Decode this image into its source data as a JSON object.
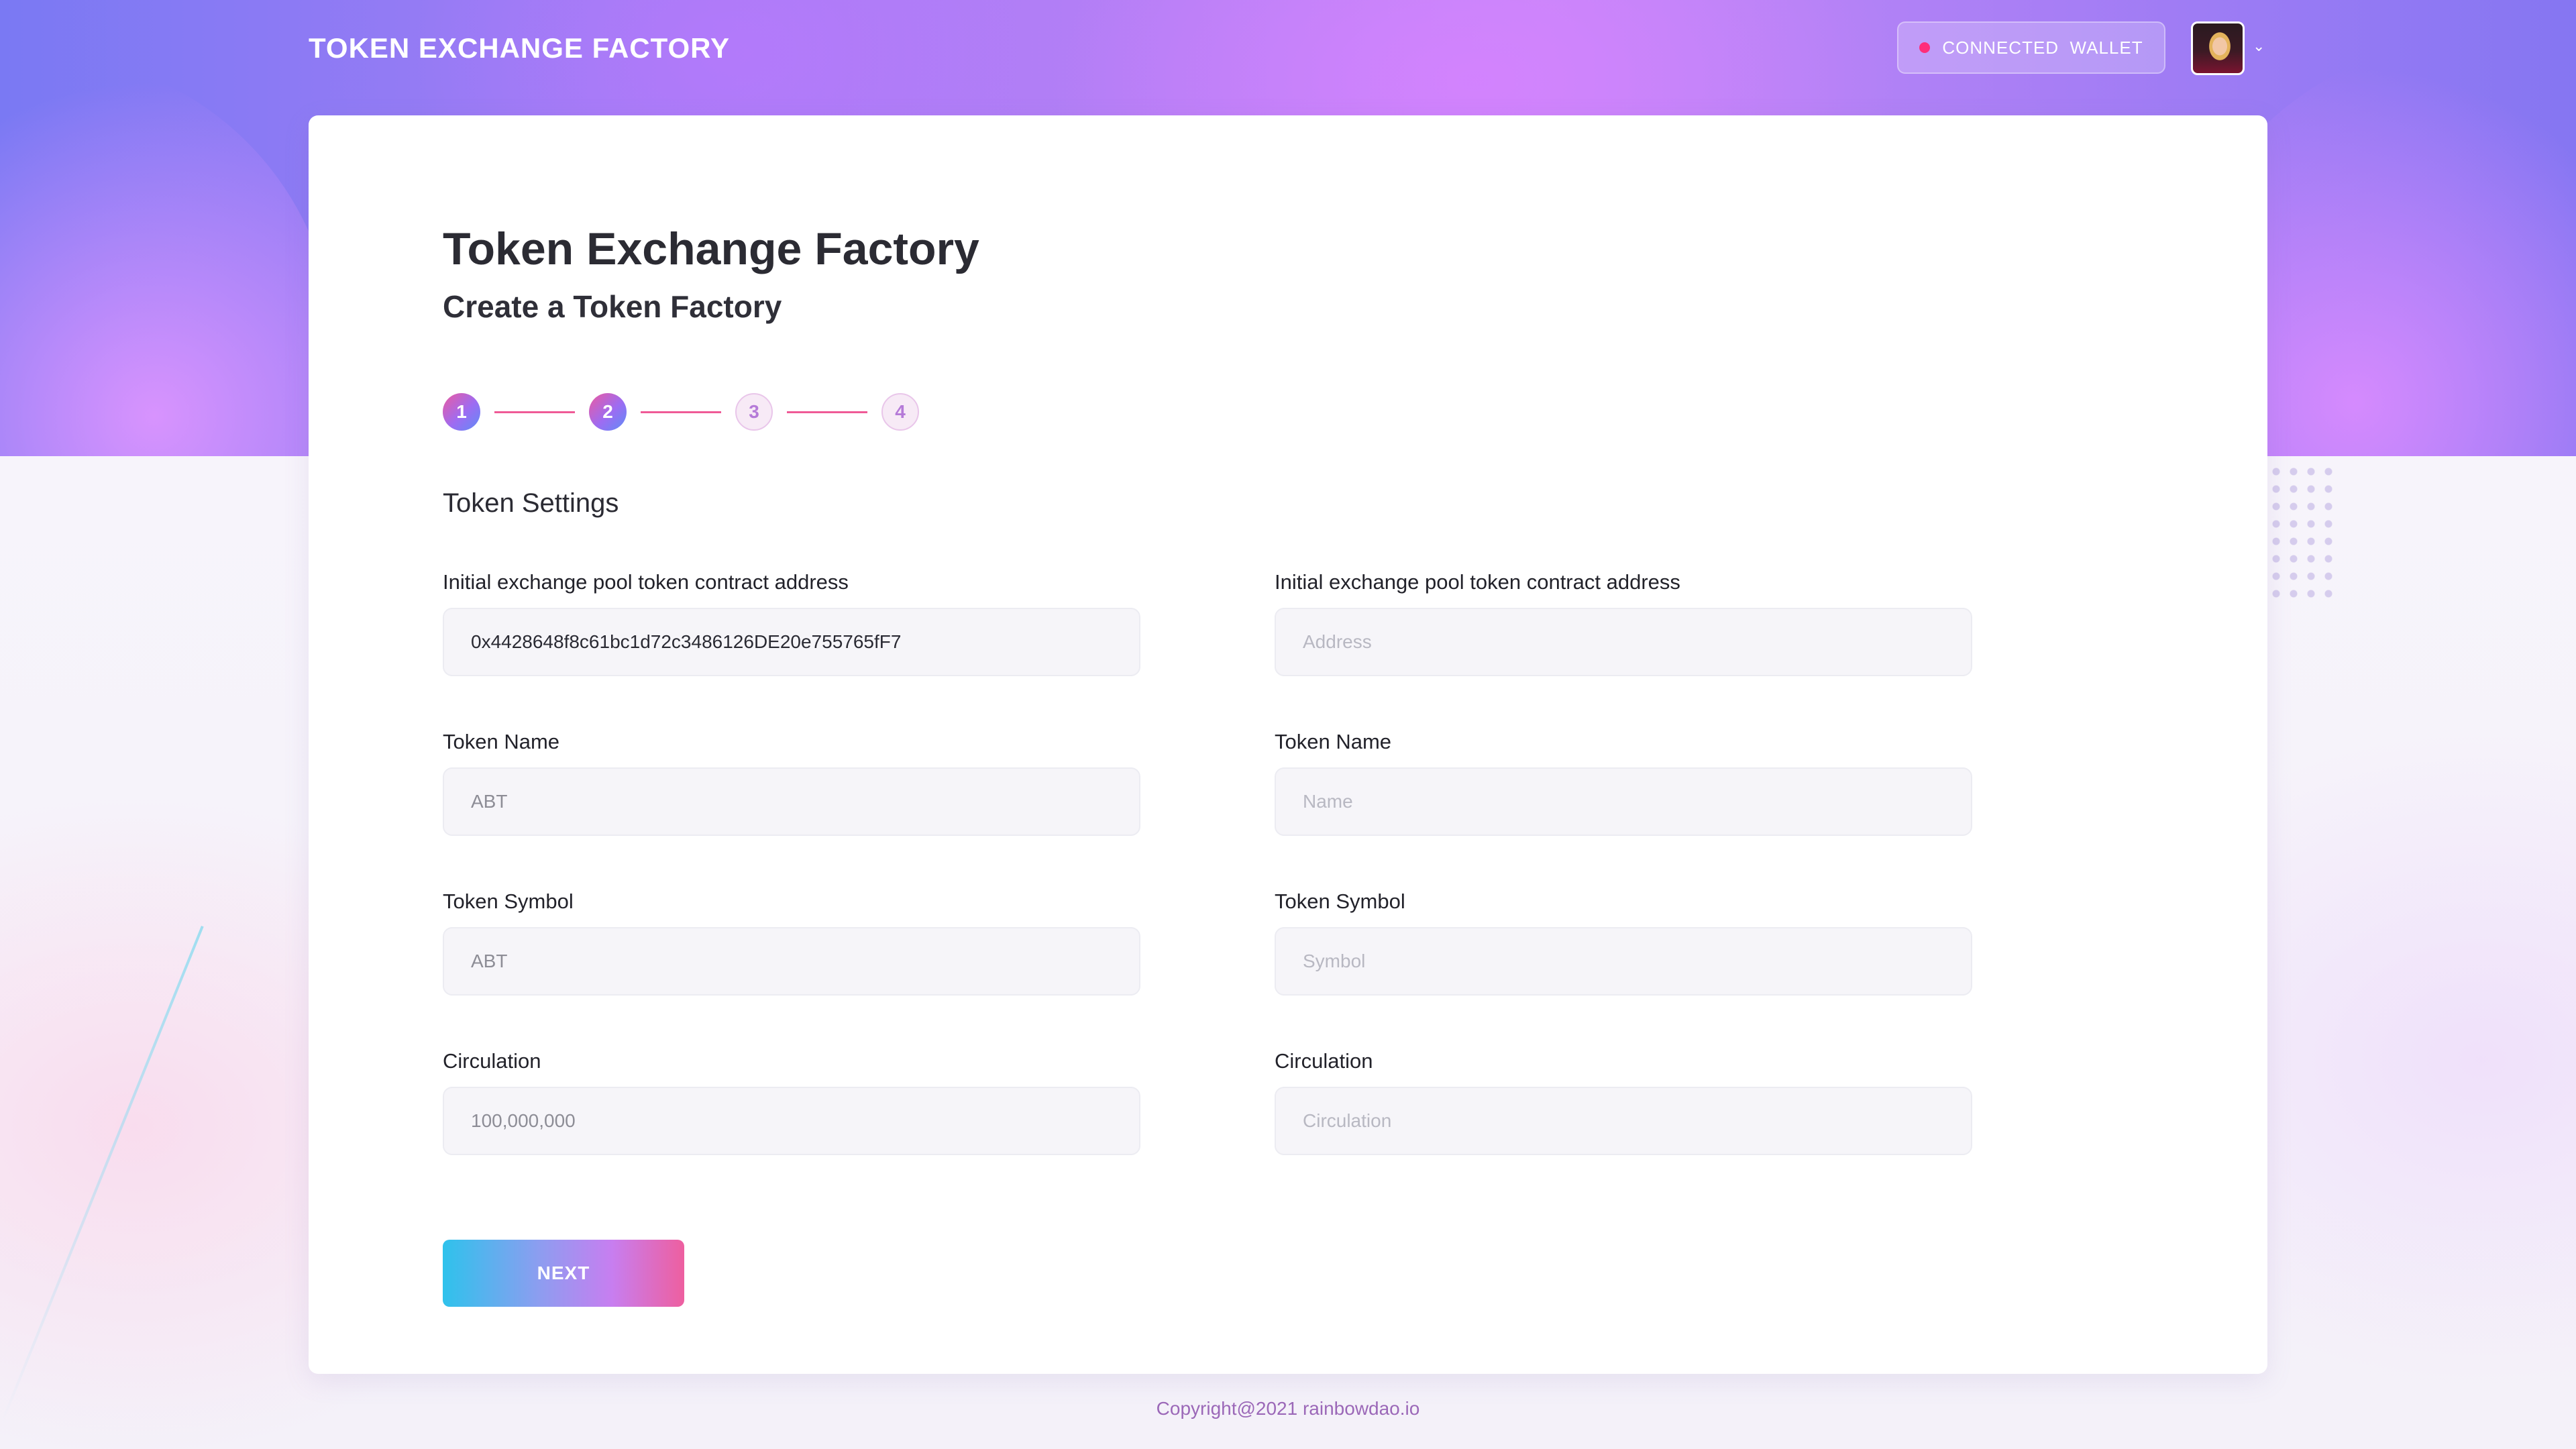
{
  "header": {
    "brand": "TOKEN EXCHANGE FACTORY",
    "wallet_label": "CONNECTED  WALLET",
    "avatar_caret": "⌄"
  },
  "page": {
    "title": "Token Exchange Factory",
    "subtitle": "Create a Token Factory"
  },
  "stepper": {
    "steps": [
      "1",
      "2",
      "3",
      "4"
    ],
    "current_step": 2
  },
  "section_title": "Token Settings",
  "form": {
    "left": {
      "address_label": "Initial exchange pool token contract address",
      "address_value": "0x4428648f8c61bc1d72c3486126DE20e755765fF7",
      "name_label": "Token Name",
      "name_value": "ABT",
      "symbol_label": "Token Symbol",
      "symbol_value": "ABT",
      "circulation_label": "Circulation",
      "circulation_value": "100,000,000"
    },
    "right": {
      "address_label": "Initial exchange pool token contract address",
      "address_placeholder": "Address",
      "name_label": "Token Name",
      "name_placeholder": "Name",
      "symbol_label": "Token Symbol",
      "symbol_placeholder": "Symbol",
      "circulation_label": "Circulation",
      "circulation_placeholder": "Circulation"
    }
  },
  "actions": {
    "next_label": "NEXT"
  },
  "footer": {
    "copyright": "Copyright@2021 rainbowdao.io"
  },
  "colors": {
    "accent_pink": "#ef5a96",
    "accent_cyan": "#2ec2ec",
    "wallet_status_dot": "#ff2d7a"
  }
}
